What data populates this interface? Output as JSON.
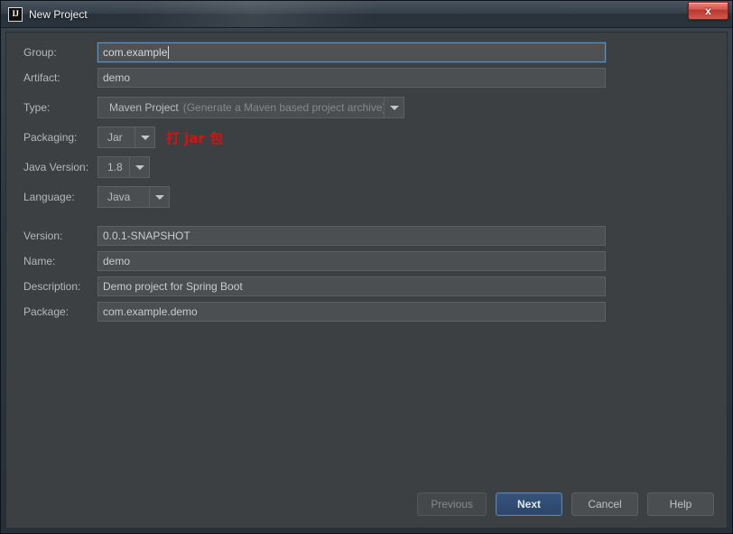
{
  "window": {
    "title": "New Project",
    "app_icon": "intellij-idea-icon",
    "app_icon_text": "IJ",
    "close_label": "x",
    "close_icon": "close-icon"
  },
  "colors": {
    "dialog_bg": "#3c4042",
    "titlebar_bg": "#2d3741",
    "field_bg": "#4b4f51",
    "focus_border": "#5894c9",
    "default_button_bg": "#2d4f7c",
    "annotation_red": "#e20d0d",
    "label_text": "#b5b8ba",
    "close_button_red": "#c2453a"
  },
  "form": {
    "fields": [
      {
        "label": "Group:",
        "value": "com.example",
        "kind": "text",
        "focused": true
      },
      {
        "label": "Artifact:",
        "value": "demo",
        "kind": "text",
        "focused": false
      },
      {
        "label": "Type:",
        "value": "Maven Project",
        "hint": "(Generate a Maven based project archive)",
        "kind": "combo"
      },
      {
        "label": "Packaging:",
        "value": "Jar",
        "kind": "combo",
        "annotation": "打 jar 包"
      },
      {
        "label": "Java Version:",
        "value": "1.8",
        "kind": "combo"
      },
      {
        "label": "Language:",
        "value": "Java",
        "kind": "combo"
      },
      {
        "label": "Version:",
        "value": "0.0.1-SNAPSHOT",
        "kind": "text",
        "focused": false
      },
      {
        "label": "Name:",
        "value": "demo",
        "kind": "text",
        "focused": false
      },
      {
        "label": "Description:",
        "value": "Demo project for Spring Boot",
        "kind": "text",
        "focused": false
      },
      {
        "label": "Package:",
        "value": "com.example.demo",
        "kind": "text",
        "focused": false
      }
    ]
  },
  "buttons": {
    "previous": "Previous",
    "next": "Next",
    "cancel": "Cancel",
    "help": "Help"
  }
}
